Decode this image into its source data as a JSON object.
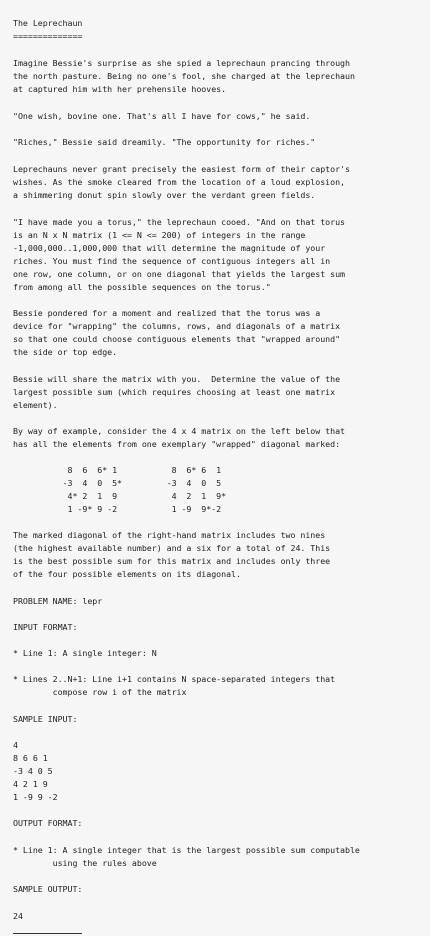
{
  "lines": [
    "The Leprechaun",
    "==============",
    "Imagine Bessie's surprise as she spied a leprechaun prancing through",
    "the north pasture. Being no one's fool, she charged at the leprechaun",
    "at captured him with her prehensile hooves.",
    "\"One wish, bovine one. That's all I have for cows,\" he said.",
    "\"Riches,\" Bessie said dreamily. \"The opportunity for riches.\"",
    "Leprechauns never grant precisely the easiest form of their captor's",
    "wishes. As the smoke cleared from the location of a loud explosion,",
    "a shimmering donut spin slowly over the verdant green fields.",
    "\"I have made you a torus,\" the leprechaun cooed. \"And on that torus",
    "is an N x N matrix (1 <= N <= 200) of integers in the range",
    "-1,000,000..1,000,000 that will determine the magnitude of your",
    "riches. You must find the sequence of contiguous integers all in",
    "one row, one column, or on one diagonal that yields the largest sum",
    "from among all the possible sequences on the torus.\"",
    "Bessie pondered for a moment and realized that the torus was a",
    "device for \"wrapping\" the columns, rows, and diagonals of a matrix",
    "so that one could choose contiguous elements that \"wrapped around\"",
    "the side or top edge.",
    "Bessie will share the matrix with you.  Determine the value of the",
    "largest possible sum (which requires choosing at least one matrix",
    "element).",
    "By way of example, consider the 4 x 4 matrix on the left below that",
    "has all the elements from one exemplary \"wrapped\" diagonal marked:",
    "           8  6  6* 1           8  6* 6  1",
    "          -3  4  0  5*         -3  4  0  5",
    "           4* 2  1  9           4  2  1  9*",
    "           1 -9* 9 -2           1 -9  9*-2",
    "The marked diagonal of the right-hand matrix includes two nines",
    "(the highest available number) and a six for a total of 24. This",
    "is the best possible sum for this matrix and includes only three",
    "of the four possible elements on its diagonal.",
    "PROBLEM NAME: lepr",
    "INPUT FORMAT:",
    "* Line 1: A single integer: N",
    "* Lines 2..N+1: Line i+1 contains N space-separated integers that",
    "        compose row i of the matrix",
    "SAMPLE INPUT:",
    "4",
    "8 6 6 1",
    "-3 4 0 5",
    "4 2 1 9",
    "1 -9 9 -2",
    "OUTPUT FORMAT:",
    "* Line 1: A single integer that is the largest possible sum computable",
    "        using the rules above",
    "SAMPLE OUTPUT:",
    "24"
  ]
}
